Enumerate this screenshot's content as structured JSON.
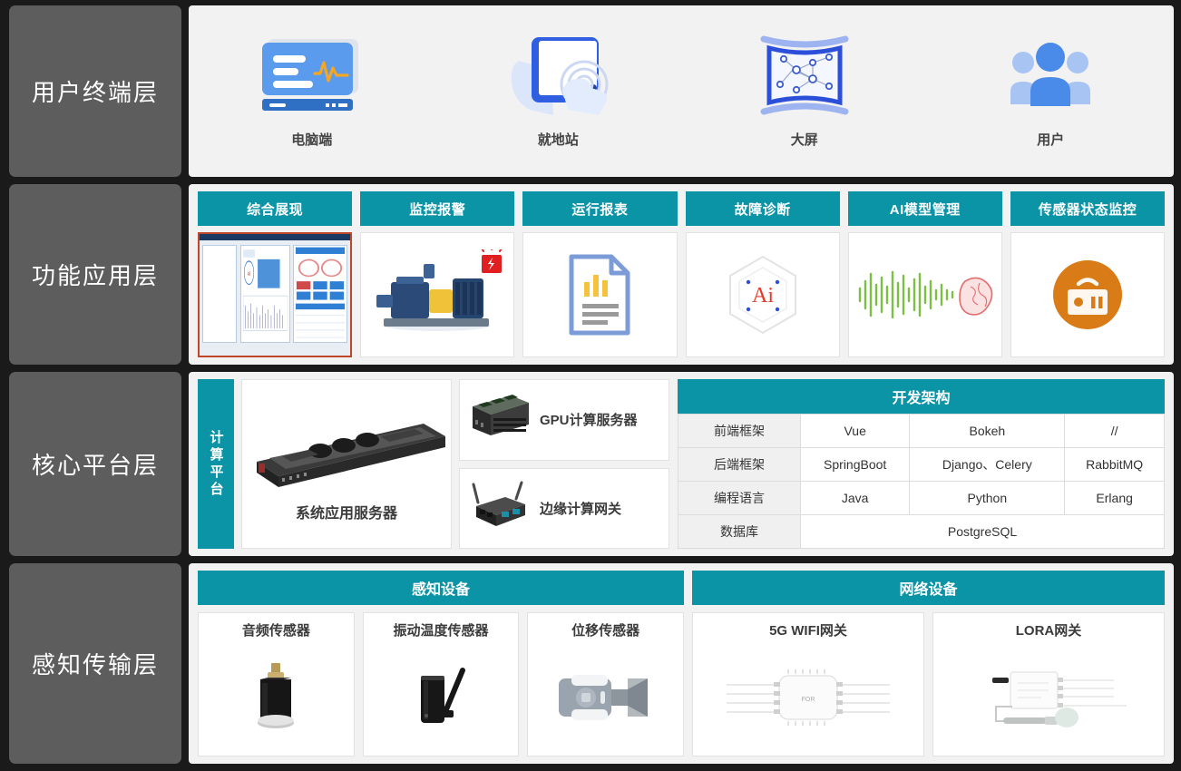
{
  "layers": [
    {
      "id": "user-terminal",
      "label": "用户终端层"
    },
    {
      "id": "function-application",
      "label": "功能应用层"
    },
    {
      "id": "core-platform",
      "label": "核心平台层"
    },
    {
      "id": "sensing-transmission",
      "label": "感知传输层"
    }
  ],
  "terminals": [
    {
      "label": "电脑端",
      "icon": "desktop-monitor-icon"
    },
    {
      "label": "就地站",
      "icon": "tablet-touch-hand-icon"
    },
    {
      "label": "大屏",
      "icon": "large-screen-network-icon"
    },
    {
      "label": "用户",
      "icon": "users-group-icon"
    }
  ],
  "apps": [
    {
      "title": "综合展现",
      "icon": "dashboard-screenshot"
    },
    {
      "title": "监控报警",
      "icon": "machine-alarm-image"
    },
    {
      "title": "运行报表",
      "icon": "report-document-icon"
    },
    {
      "title": "故障诊断",
      "icon": "ai-hexagon-icon"
    },
    {
      "title": "AI模型管理",
      "icon": "audio-waveform-brain-icon"
    },
    {
      "title": "传感器状态监控",
      "icon": "orange-sensor-circle-icon"
    }
  ],
  "core": {
    "compute_platform_label": "计算平台",
    "main_server": {
      "caption": "系统应用服务器",
      "icon": "rack-server-image"
    },
    "side_servers": [
      {
        "caption": "GPU计算服务器",
        "icon": "gpu-server-image"
      },
      {
        "caption": "边缘计算网关",
        "icon": "edge-gateway-image"
      }
    ],
    "arch": {
      "title": "开发架构",
      "rows": [
        {
          "name": "前端框架",
          "cells": [
            "Vue",
            "Bokeh",
            "//"
          ]
        },
        {
          "name": "后端框架",
          "cells": [
            "SpringBoot",
            "Django、Celery",
            "RabbitMQ"
          ]
        },
        {
          "name": "编程语言",
          "cells": [
            "Java",
            "Python",
            "Erlang"
          ]
        },
        {
          "name": "数据库",
          "cells": [
            "PostgreSQL"
          ]
        }
      ]
    }
  },
  "sensing": {
    "groups": [
      {
        "title": "感知设备",
        "devices": [
          {
            "label": "音频传感器",
            "icon": "audio-sensor-image"
          },
          {
            "label": "振动温度传感器",
            "icon": "vibration-temp-sensor-image"
          },
          {
            "label": "位移传感器",
            "icon": "displacement-sensor-image"
          }
        ]
      },
      {
        "title": "网络设备",
        "devices": [
          {
            "label": "5G WIFI网关",
            "icon": "wifi-gateway-image"
          },
          {
            "label": "LORA网关",
            "icon": "lora-gateway-image"
          }
        ]
      }
    ]
  },
  "colors": {
    "background": "#1a1a1a",
    "rail_tile": "#5d5d5d",
    "panel": "#f2f2f2",
    "teal": "#0b93a6",
    "accent_orange": "#d97b16",
    "alarm_red": "#e02020",
    "blue": "#4a90e2"
  }
}
